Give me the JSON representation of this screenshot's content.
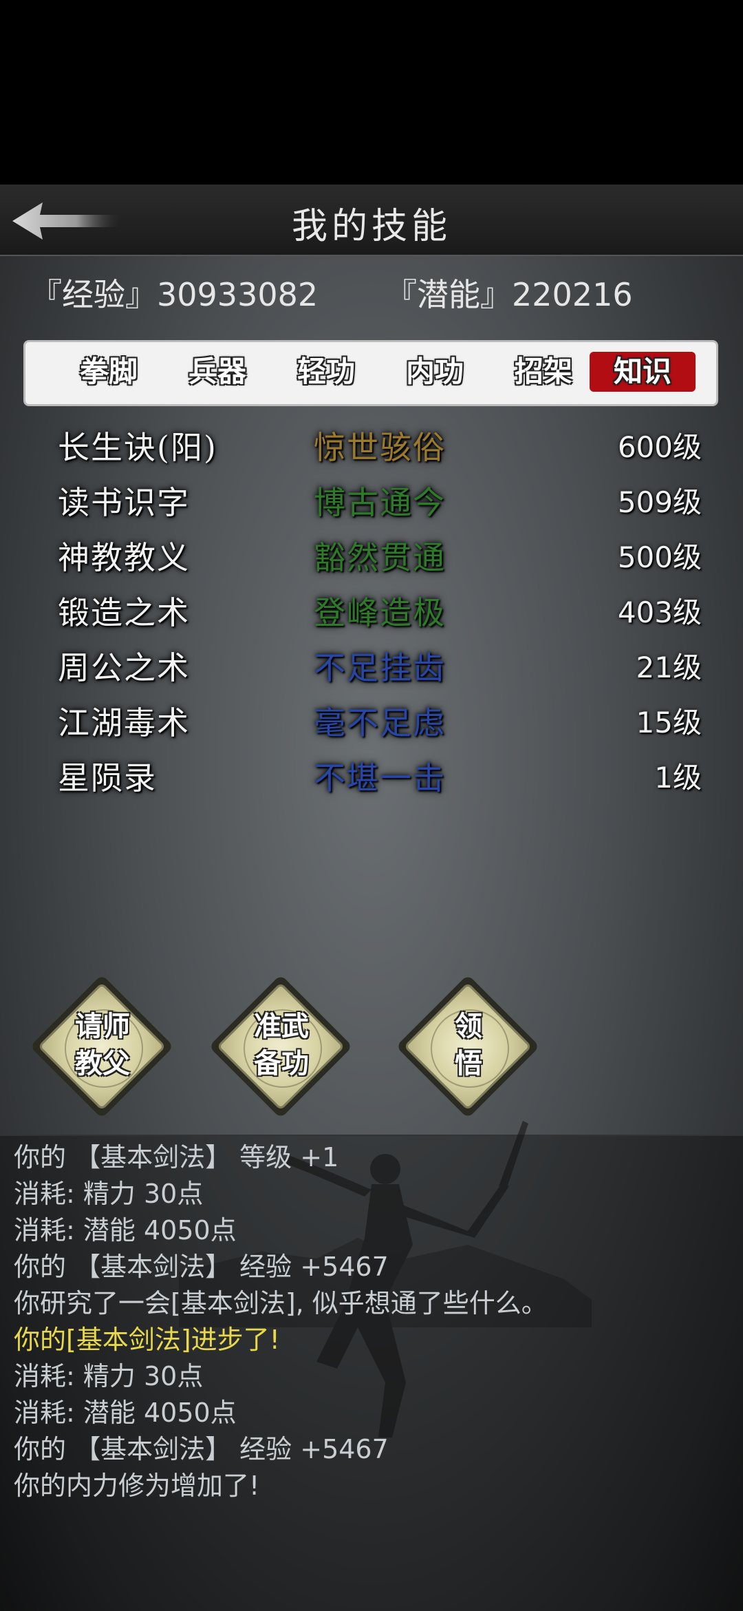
{
  "header": {
    "title": "我的技能"
  },
  "stats": {
    "exp_label": "『经验』30933082",
    "potential_label": "『潜能』220216"
  },
  "tabs": [
    {
      "label": "拳脚",
      "active": false
    },
    {
      "label": "兵器",
      "active": false
    },
    {
      "label": "轻功",
      "active": false
    },
    {
      "label": "内功",
      "active": false
    },
    {
      "label": "招架",
      "active": false
    },
    {
      "label": "知识",
      "active": true
    }
  ],
  "skills": [
    {
      "name": "长生诀(阳)",
      "rank": "惊世骇俗",
      "level": "600级",
      "rank_color": "#9b7a2e"
    },
    {
      "name": "读书识字",
      "rank": "博古通今",
      "level": "509级",
      "rank_color": "#2f7a2a"
    },
    {
      "name": "神教教义",
      "rank": "豁然贯通",
      "level": "500级",
      "rank_color": "#2f7a2a"
    },
    {
      "name": "锻造之术",
      "rank": "登峰造极",
      "level": "403级",
      "rank_color": "#2f7a2a"
    },
    {
      "name": "周公之术",
      "rank": "不足挂齿",
      "level": "21级",
      "rank_color": "#2845a8"
    },
    {
      "name": "江湖毒术",
      "rank": "毫不足虑",
      "level": "15级",
      "rank_color": "#2845a8"
    },
    {
      "name": "星陨录",
      "rank": "不堪一击",
      "level": "1级",
      "rank_color": "#2845a8"
    }
  ],
  "actions": [
    {
      "line1": "请师",
      "line2": "教父"
    },
    {
      "line1": "准武",
      "line2": "备功"
    },
    {
      "line1": "领",
      "line2": "悟"
    }
  ],
  "log": [
    {
      "text": "你的 【基本剑法】 等级 +1",
      "highlight": false
    },
    {
      "text": "消耗: 精力 30点",
      "highlight": false
    },
    {
      "text": "消耗: 潜能 4050点",
      "highlight": false
    },
    {
      "text": "你的 【基本剑法】 经验 +5467",
      "highlight": false
    },
    {
      "text": "你研究了一会[基本剑法], 似乎想通了些什么。",
      "highlight": false
    },
    {
      "text": "你的[基本剑法]进步了!",
      "highlight": true
    },
    {
      "text": "消耗: 精力 30点",
      "highlight": false
    },
    {
      "text": "消耗: 潜能 4050点",
      "highlight": false
    },
    {
      "text": "你的 【基本剑法】 经验 +5467",
      "highlight": false
    },
    {
      "text": "你的内力修为增加了!",
      "highlight": false
    }
  ]
}
